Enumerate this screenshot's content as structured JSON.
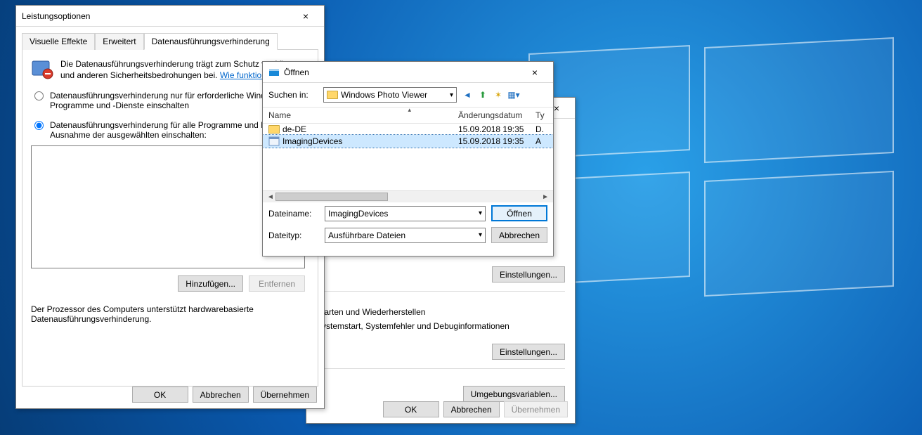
{
  "w1": {
    "title": "Leistungsoptionen",
    "tabs": [
      "Visuelle Effekte",
      "Erweitert",
      "Datenausführungsverhinderung"
    ],
    "desc_text": "Die Datenausführungsverhinderung trägt zum Schutz vor Viren und anderen Sicherheitsbedrohungen bei.",
    "desc_link": "Wie funktioniert sie?",
    "radio1": "Datenausführungsverhinderung nur für erforderliche Windows-Programme und -Dienste einschalten",
    "radio2": "Datenausführungsverhinderung für alle Programme und Dienste mit Ausnahme der ausgewählten einschalten:",
    "add_btn": "Hinzufügen...",
    "remove_btn": "Entfernen",
    "proc_note": "Der Prozessor des Computers unterstützt hardwarebasierte Datenausführungsverhinderung.",
    "ok": "OK",
    "cancel": "Abbrechen",
    "apply": "Übernehmen"
  },
  "w2": {
    "close": "×",
    "settings_btn_top": "Einstellungen...",
    "group_title": "Starten und Wiederherstellen",
    "group_desc": "Systemstart, Systemfehler und Debuginformationen",
    "settings_btn": "Einstellungen...",
    "env_btn": "Umgebungsvariablen...",
    "ok": "OK",
    "cancel": "Abbrechen",
    "apply": "Übernehmen"
  },
  "w3": {
    "title": "Öffnen",
    "search_label": "Suchen in:",
    "folder": "Windows Photo Viewer",
    "hdr_name": "Name",
    "hdr_date": "Änderungsdatum",
    "hdr_type": "Ty",
    "rows": [
      {
        "name": "de-DE",
        "date": "15.09.2018 19:35",
        "type": "D."
      },
      {
        "name": "ImagingDevices",
        "date": "15.09.2018 19:35",
        "type": "A"
      }
    ],
    "filename_label": "Dateiname:",
    "filename_value": "ImagingDevices",
    "filetype_label": "Dateityp:",
    "filetype_value": "Ausführbare Dateien",
    "open": "Öffnen",
    "cancel": "Abbrechen"
  }
}
